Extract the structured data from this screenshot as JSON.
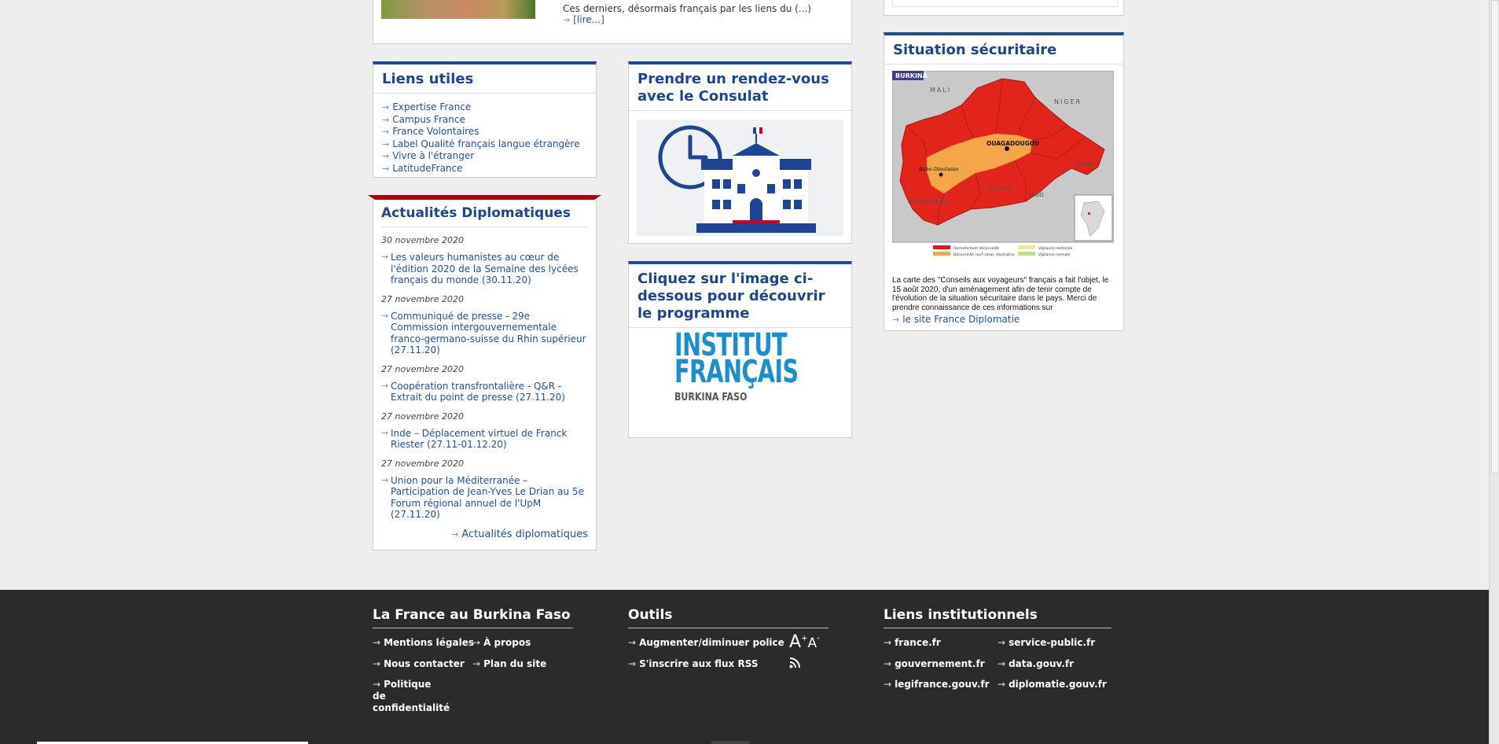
{
  "top_article": {
    "excerpt": "Ces derniers, désormais français par les liens du (...)",
    "more": "[lire...]"
  },
  "liens_utiles": {
    "title": "Liens utiles",
    "items": [
      {
        "label": "Expertise France"
      },
      {
        "label": "Campus France"
      },
      {
        "label": "France Volontaires"
      },
      {
        "label": "Label Qualité français langue étrangère"
      },
      {
        "label": "Vivre à l'étranger"
      },
      {
        "label": "LatitudeFrance"
      }
    ]
  },
  "actualites": {
    "title": "Actualités Diplomatiques",
    "items": [
      {
        "date": "30 novembre 2020",
        "text": "Les valeurs humanistes au cœur de l'édition 2020 de la Semaine des lycées français du monde (30.11.20)"
      },
      {
        "date": "27 novembre 2020",
        "text": "Communiqué de presse - 29e Commission intergouvernementale franco-germano-suisse du Rhin supérieur (27.11.20)"
      },
      {
        "date": "27 novembre 2020",
        "text": "Coopération transfrontalière - Q&R - Extrait du point de presse (27.11.20)"
      },
      {
        "date": "27 novembre 2020",
        "text": "Inde – Déplacement virtuel de Franck Riester (27.11-01.12.20)"
      },
      {
        "date": "27 novembre 2020",
        "text": "Union pour la Méditerranée – Participation de Jean-Yves Le Drian au 5e Forum régional annuel de l'UpM (27.11.20)"
      }
    ],
    "all_link": "Actualités diplomatiques"
  },
  "consulat": {
    "title": "Prendre un rendez-vous avec le Consulat"
  },
  "institut": {
    "title": "Cliquez sur l'image ci-dessous pour découvrir le programme",
    "logo_line1": "INSTITUT",
    "logo_line2": "FRANÇAIS",
    "logo_line3": "BURKINA FASO"
  },
  "situation": {
    "title": "Situation sécuritaire",
    "map_labels": {
      "country": "BURKINA",
      "mali": "MALI",
      "niger": "NIGER",
      "ghana": "GHANA",
      "benin": "BÉNIN",
      "togo": "TOGO",
      "cote": "CÔTE D'IVOIRE",
      "capital": "OUAGADOUGOU",
      "bobo": "Bobo-Dioulasso"
    },
    "legend": [
      {
        "label": "Formellement déconseillé",
        "color": "#e11a10"
      },
      {
        "label": "Déconseillé sauf raison impérative",
        "color": "#f5a54a"
      },
      {
        "label": "Vigilance renforcée",
        "color": "#f3ec8f"
      },
      {
        "label": "Vigilance normale",
        "color": "#bfe07a"
      }
    ],
    "caption": "La carte des \"Conseils aux voyageurs\" français a fait l'objet, le 15 août 2020, d'un aménagement afin de tenir compte de l'évolution de la situation sécuritaire dans le pays. Merci de prendre connaissance de ces informations sur",
    "link": "le site France Diplomatie"
  },
  "footer": {
    "col1": {
      "title": "La France au Burkina Faso",
      "links": [
        "Mentions légales",
        "À propos",
        "Nous contacter",
        "Plan du site",
        "Politique de confidentialité"
      ]
    },
    "col2": {
      "title": "Outils",
      "links": [
        "Augmenter/diminuer police",
        "S'inscrire aux flux RSS"
      ]
    },
    "col3": {
      "title": "Liens institutionnels",
      "links": [
        "france.fr",
        "service-public.fr",
        "gouvernement.fr",
        "data.gouv.fr",
        "legifrance.gouv.fr",
        "diplomatie.gouv.fr"
      ]
    }
  }
}
